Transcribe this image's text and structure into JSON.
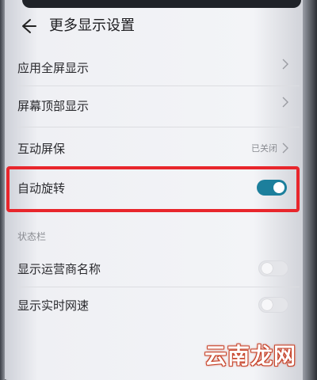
{
  "header": {
    "title": "更多显示设置",
    "back_icon": "back-arrow-icon"
  },
  "rows": [
    {
      "label": "应用全屏显示",
      "type": "nav"
    },
    {
      "label": "屏幕顶部显示",
      "type": "nav"
    },
    {
      "label": "互动屏保",
      "type": "nav",
      "status": "已关闭"
    },
    {
      "label": "自动旋转",
      "type": "toggle",
      "on": true
    }
  ],
  "status_bar_section": {
    "heading": "状态栏",
    "rows": [
      {
        "label": "显示运营商名称",
        "type": "toggle",
        "on": false
      },
      {
        "label": "显示实时网速",
        "type": "toggle",
        "on": false
      }
    ]
  },
  "watermark": "云南龙网",
  "colors": {
    "accent": "#1c7f9c",
    "highlight": "#e8262c"
  }
}
